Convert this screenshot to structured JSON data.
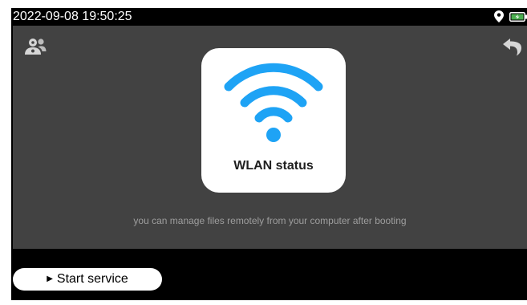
{
  "status_bar": {
    "datetime": "2022-09-08 19:50:25",
    "icons": [
      "location-icon",
      "battery-icon"
    ],
    "battery_color": "#4caf50"
  },
  "toolbar": {
    "left_icon": "users-icon",
    "right_icon": "back-icon"
  },
  "main": {
    "card_label": "WLAN status",
    "card_icon": "wifi-icon",
    "wifi_color": "#1ea3f5",
    "hint": "you can manage files remotely from your computer after booting"
  },
  "footer": {
    "start_arrow": "▶",
    "start_label": "Start service"
  },
  "colors": {
    "background": "#000000",
    "panel": "#424242",
    "accent": "#1ea3f5"
  }
}
